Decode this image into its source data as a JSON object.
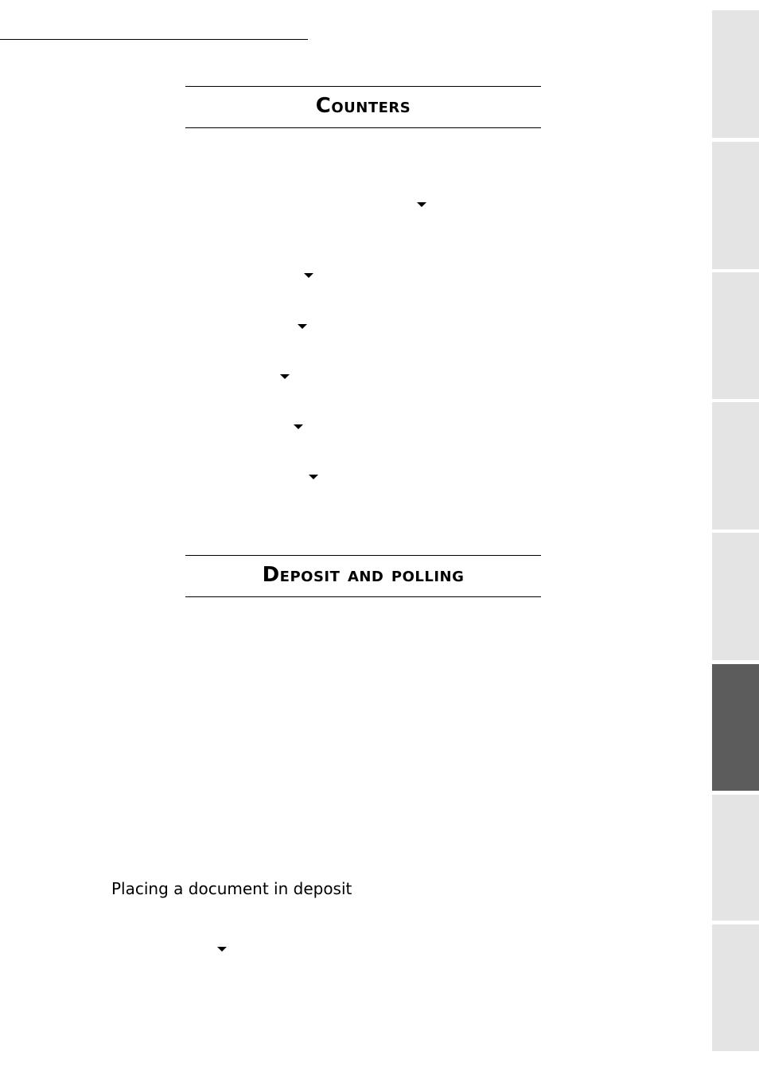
{
  "sections": {
    "counters": {
      "title": "Counters"
    },
    "deposit": {
      "title": "Deposit and polling"
    }
  },
  "subheadings": {
    "placing_deposit": "Placing a document in deposit"
  },
  "icons": {
    "menu_arrow": "down-triangle-icon"
  },
  "side_tabs": {
    "count": 8,
    "active_index": 5,
    "colors": {
      "inactive": "#e4e4e4",
      "active": "#5c5c5c"
    }
  }
}
